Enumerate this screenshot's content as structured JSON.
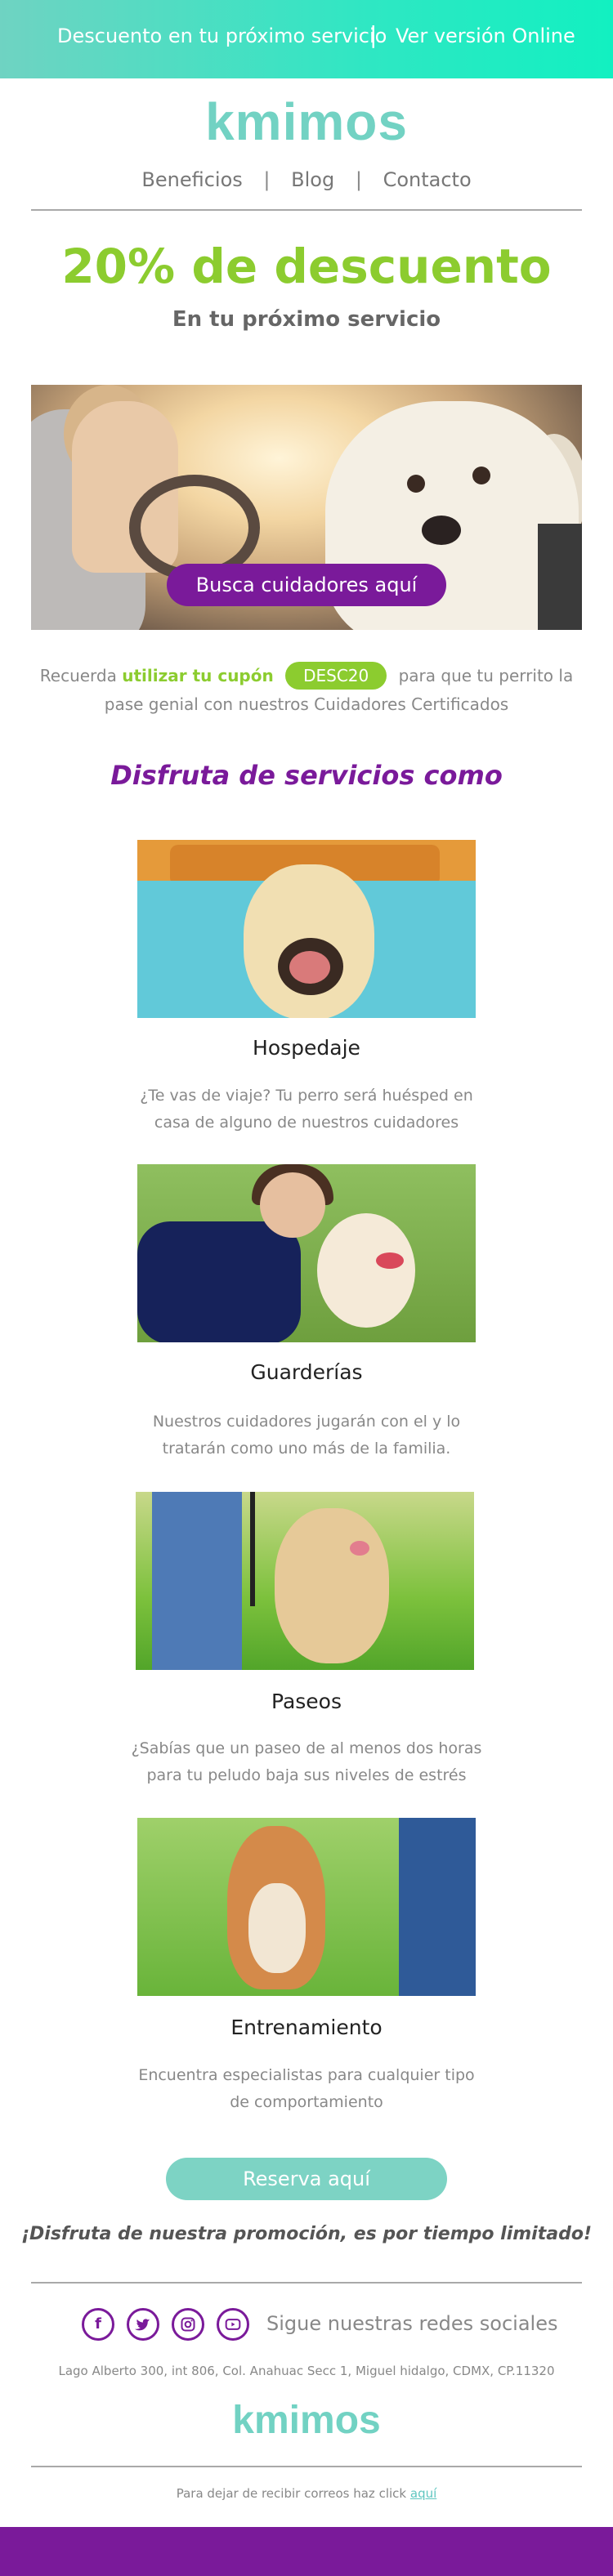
{
  "topbar": {
    "left_text": "Descuento en tu próximo servicio",
    "separator": "|",
    "right_text": "Ver versión Online"
  },
  "brand": {
    "logo_text": "kmimos"
  },
  "nav": {
    "items": [
      "Beneficios",
      "Blog",
      "Contacto"
    ],
    "separator": "|"
  },
  "hero": {
    "headline": "20% de descuento",
    "subheadline": "En tu próximo servicio",
    "cta_label": "Busca cuidadores aquí"
  },
  "coupon": {
    "prefix": "Recuerda",
    "highlight": "utilizar tu cupón",
    "code": "DESC20",
    "suffix": "para que tu perrito la",
    "line2": "pase genial con nuestros Cuidadores Certificados"
  },
  "services": {
    "heading": "Disfruta de servicios como",
    "items": [
      {
        "title": "Hospedaje",
        "desc1": "¿Te vas de viaje? Tu perro será huésped en",
        "desc2": "casa de alguno de nuestros cuidadores"
      },
      {
        "title": "Guarderías",
        "desc1": "Nuestros cuidadores jugarán con el y lo",
        "desc2": "tratarán como uno más de la familia."
      },
      {
        "title": "Paseos",
        "desc1": "¿Sabías que un paseo de al menos dos horas",
        "desc2": "para tu peludo baja sus niveles de estrés"
      },
      {
        "title": "Entrenamiento",
        "desc1": "Encuentra especialistas para cualquier tipo",
        "desc2": "de comportamiento"
      }
    ]
  },
  "reserve": {
    "cta_label": "Reserva aquí",
    "promo_text": "¡Disfruta de nuestra promoción, es por tiempo limitado!"
  },
  "footer": {
    "social_label": "Sigue nuestras redes sociales",
    "social_icons": [
      "facebook-icon",
      "twitter-icon",
      "instagram-icon",
      "youtube-icon"
    ],
    "address": "Lago Alberto 300, int 806, Col. Anahuac Secc 1, Miguel hidalgo, CDMX, CP.11320",
    "unsubscribe_text": "Para dejar de recibir correos haz click",
    "unsubscribe_link": "aquí"
  },
  "colors": {
    "teal": "#72d2c3",
    "green": "#8ccc2f",
    "purple": "#7a1a9a"
  }
}
